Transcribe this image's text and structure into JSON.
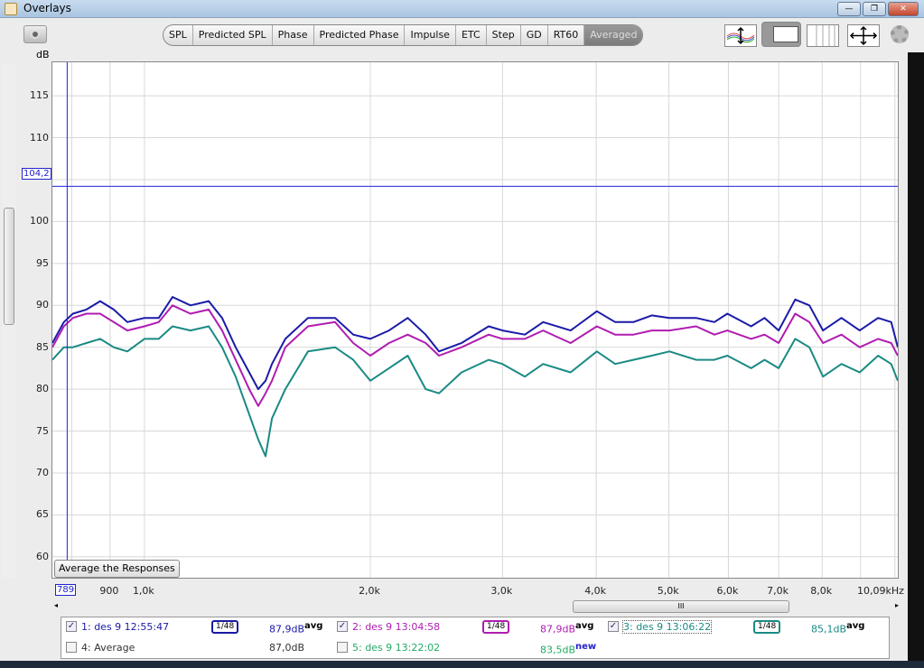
{
  "window": {
    "title": "Overlays",
    "minimize": "—",
    "restore": "❐",
    "close": "✕"
  },
  "tabs": [
    {
      "label": "SPL"
    },
    {
      "label": "Predicted SPL"
    },
    {
      "label": "Phase"
    },
    {
      "label": "Predicted Phase"
    },
    {
      "label": "Impulse"
    },
    {
      "label": "ETC"
    },
    {
      "label": "Step"
    },
    {
      "label": "GD"
    },
    {
      "label": "RT60"
    },
    {
      "label": "Averaged",
      "active": true
    }
  ],
  "toolbar_icons": [
    "camera-icon",
    "y-scale-icon",
    "window-layout-icon",
    "grid-columns-icon",
    "pan-arrows-icon",
    "gear-icon"
  ],
  "cursor": {
    "y_label": "104,2",
    "x_label": "789",
    "y_value": 104.2,
    "x_value": 789
  },
  "avg_button": "Average the Responses",
  "scroll_mark": "III",
  "chart_data": {
    "type": "line",
    "ylabel": "dB",
    "ylim": [
      57.5,
      119
    ],
    "xlim": [
      754,
      10090
    ],
    "xscale": "log",
    "yticks": [
      {
        "v": 115,
        "l": "115"
      },
      {
        "v": 110,
        "l": "110"
      },
      {
        "v": 100,
        "l": "100"
      },
      {
        "v": 95,
        "l": "95"
      },
      {
        "v": 90,
        "l": "90"
      },
      {
        "v": 85,
        "l": "85"
      },
      {
        "v": 80,
        "l": "80"
      },
      {
        "v": 75,
        "l": "75"
      },
      {
        "v": 70,
        "l": "70"
      },
      {
        "v": 65,
        "l": "65"
      },
      {
        "v": 60,
        "l": "60"
      }
    ],
    "xticks": [
      {
        "v": 900,
        "l": "900"
      },
      {
        "v": 1000,
        "l": "1,0k"
      },
      {
        "v": 2000,
        "l": "2,0k"
      },
      {
        "v": 3000,
        "l": "3,0k"
      },
      {
        "v": 4000,
        "l": "4,0k"
      },
      {
        "v": 5000,
        "l": "5,0k"
      },
      {
        "v": 6000,
        "l": "6,0k"
      },
      {
        "v": 7000,
        "l": "7,0k"
      },
      {
        "v": 8000,
        "l": "8,0k"
      },
      {
        "v": 10090,
        "l": "10,09kHz"
      }
    ],
    "x": [
      754,
      781,
      803,
      837,
      873,
      910,
      949,
      1000,
      1045,
      1090,
      1152,
      1218,
      1269,
      1323,
      1379,
      1418,
      1450,
      1479,
      1541,
      1652,
      1795,
      1898,
      2000,
      2118,
      2243,
      2370,
      2469,
      2646,
      2875,
      3000,
      3213,
      3398,
      3697,
      4007,
      4239,
      4483,
      4743,
      5008,
      5434,
      5747,
      5981,
      6433,
      6704,
      7000,
      7364,
      7693,
      8021,
      8487,
      8977,
      9498,
      9887,
      10090
    ],
    "series": [
      {
        "name": "1: des 9 12:55:47",
        "color": "#1a1aa8",
        "values": [
          85.5,
          88,
          89,
          89.5,
          90.5,
          89.5,
          88,
          88.5,
          88.5,
          91,
          90,
          90.5,
          88.5,
          85,
          82,
          80,
          81,
          83,
          86,
          88.5,
          88.5,
          86.5,
          86,
          87,
          88.5,
          86.5,
          84.5,
          85.5,
          87.5,
          87,
          86.5,
          88,
          87,
          89.3,
          88,
          88,
          88.8,
          88.5,
          88.5,
          88,
          89,
          87.5,
          88.5,
          87,
          90.7,
          90,
          87,
          88.5,
          87,
          88.5,
          88,
          85
        ]
      },
      {
        "name": "2: des 9 13:04:58",
        "color": "#b01cb0",
        "values": [
          85,
          87.5,
          88.5,
          89,
          89,
          88,
          87,
          87.5,
          88,
          90,
          89,
          89.5,
          87,
          83.5,
          80,
          78,
          79.5,
          81,
          85,
          87.5,
          88,
          85.5,
          84,
          85.5,
          86.5,
          85.5,
          84,
          85,
          86.5,
          86,
          86,
          87,
          85.5,
          87.5,
          86.5,
          86.5,
          87,
          87,
          87.5,
          86.5,
          87,
          86,
          86.5,
          85.5,
          89,
          88,
          85.5,
          86.5,
          85,
          86,
          85.5,
          84
        ]
      },
      {
        "name": "3: des 9 13:06:22",
        "color": "#1a8a84",
        "values": [
          83.5,
          85,
          85,
          85.5,
          86,
          85,
          84.5,
          86,
          86,
          87.5,
          87,
          87.5,
          85,
          81.5,
          77,
          74,
          72,
          76.5,
          80,
          84.5,
          85,
          83.5,
          81,
          82.5,
          84,
          80,
          79.5,
          82,
          83.5,
          83,
          81.5,
          83,
          82,
          84.5,
          83,
          83.5,
          84,
          84.5,
          83.5,
          83.5,
          84,
          82.5,
          83.5,
          82.5,
          86,
          85,
          81.5,
          83,
          82,
          84,
          83,
          81
        ]
      }
    ]
  },
  "legend": [
    {
      "label": "1: des 9 12:55:47",
      "checked": true,
      "smoothing": "1/48",
      "level": "87,9dB",
      "tag": "avg",
      "color": "#1a1aa8"
    },
    {
      "label": "2: des 9 13:04:58",
      "checked": true,
      "smoothing": "1/48",
      "level": "87,9dB",
      "tag": "avg",
      "color": "#b01cb0"
    },
    {
      "label": "3: des 9 13:06:22",
      "checked": true,
      "smoothing": "1/48",
      "level": "85,1dB",
      "tag": "avg",
      "color": "#1a8a84"
    },
    {
      "label": "4: Average",
      "checked": false,
      "level": "87,0dB",
      "color": "#333333"
    },
    {
      "label": "5: des 9 13:22:02",
      "checked": false,
      "level": "83,5dB",
      "tag": "new",
      "color": "#22aa66"
    }
  ]
}
